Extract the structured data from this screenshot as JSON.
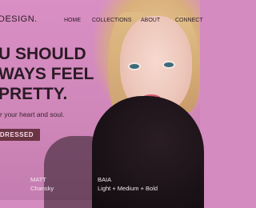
{
  "brand": "DESIGN.",
  "nav": {
    "items": [
      "HOME",
      "COLLECTIONS",
      "ABOUT",
      "CONNECT"
    ]
  },
  "hero": {
    "headline_lines": [
      "U SHOULD",
      "WAYS FEEL",
      "PRETTY."
    ],
    "subtitle": "r your heart and soul.",
    "cta_label": "DRESSED"
  },
  "font_credits": [
    {
      "name": "MATT",
      "detail": "Chansky"
    },
    {
      "name": "BAIA",
      "detail": "Light + Medium + Bold"
    }
  ],
  "colors": {
    "background": "#d48bbf",
    "text": "#2b1a25",
    "button": "#6a3444"
  }
}
